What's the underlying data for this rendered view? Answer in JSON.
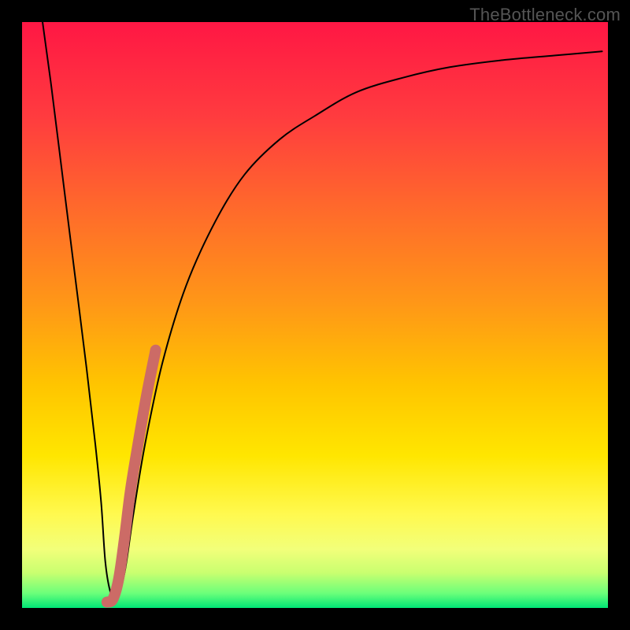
{
  "watermark": "TheBottleneck.com",
  "chart_data": {
    "type": "line",
    "title": "",
    "xlabel": "",
    "ylabel": "",
    "xlim": [
      0,
      100
    ],
    "ylim": [
      0,
      100
    ],
    "grid": false,
    "series": [
      {
        "name": "bottleneck-curve",
        "style": "thin-black",
        "x_pct": [
          3.5,
          5,
          7,
          9,
          11,
          12.5,
          13.5,
          14.2,
          15,
          16,
          17.5,
          19,
          21,
          24,
          28,
          33,
          38,
          44,
          50,
          57,
          65,
          73,
          82,
          91,
          99
        ],
        "y_pct": [
          100,
          89,
          73,
          57,
          41,
          28,
          18,
          8,
          3,
          1,
          6,
          16,
          28,
          42,
          55,
          66,
          74,
          80,
          84,
          88,
          90.5,
          92.3,
          93.5,
          94.3,
          95
        ]
      },
      {
        "name": "highlight-segment",
        "style": "thick-rosy",
        "x_pct": [
          14.5,
          15.5,
          16.5,
          17.5,
          18.5,
          19.8,
          21.2,
          22.8
        ],
        "y_pct": [
          1,
          1.5,
          5,
          12,
          20,
          28,
          36,
          44
        ]
      }
    ],
    "gradient_stops": [
      {
        "offset": 0.0,
        "color": "#ff1744"
      },
      {
        "offset": 0.16,
        "color": "#ff3b3f"
      },
      {
        "offset": 0.32,
        "color": "#ff6a2b"
      },
      {
        "offset": 0.48,
        "color": "#ff9717"
      },
      {
        "offset": 0.62,
        "color": "#ffc500"
      },
      {
        "offset": 0.74,
        "color": "#ffe600"
      },
      {
        "offset": 0.84,
        "color": "#fff94f"
      },
      {
        "offset": 0.9,
        "color": "#f2ff7a"
      },
      {
        "offset": 0.94,
        "color": "#c9ff70"
      },
      {
        "offset": 0.975,
        "color": "#6bff7a"
      },
      {
        "offset": 1.0,
        "color": "#00e676"
      }
    ],
    "highlight_color": "#cc6b66",
    "curve_color": "#000000"
  }
}
